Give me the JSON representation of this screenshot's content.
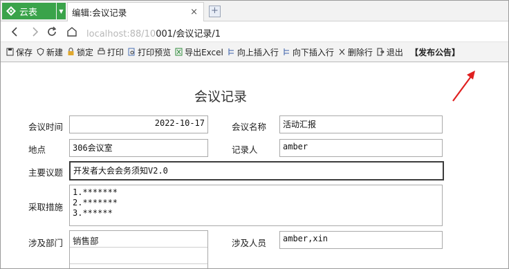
{
  "tab_bar": {
    "app_name": "云表",
    "active_tab_title": "编辑:会议记录",
    "close_glyph": "×",
    "new_tab_glyph": "+"
  },
  "address_bar": {
    "url_faded": "localhost:88/10",
    "url_main": "001/会议记录/1"
  },
  "toolbar": {
    "save": "保存",
    "new": "新建",
    "lock": "锁定",
    "print": "打印",
    "print_preview": "打印预览",
    "export_excel": "导出Excel",
    "insert_above": "向上插入行",
    "insert_below": "向下插入行",
    "delete_row": "删除行",
    "exit": "退出",
    "publish_announcement": "【发布公告】"
  },
  "form": {
    "title": "会议记录",
    "meeting_time_label": "会议时间",
    "meeting_time_value": "2022-10-17",
    "meeting_name_label": "会议名称",
    "meeting_name_value": "活动汇报",
    "location_label": "地点",
    "location_value": "306会议室",
    "recorder_label": "记录人",
    "recorder_value": "amber",
    "topic_label": "主要议题",
    "topic_value": "开发者大会会务须知V2.0",
    "measures_label": "采取措施",
    "measures_lines": [
      "1.*******",
      "2.*******",
      "3.******"
    ],
    "department_label": "涉及部门",
    "departments": [
      "销售部",
      "",
      ""
    ],
    "people_label": "涉及人员",
    "people_value": "amber,xin"
  },
  "colors": {
    "app_green": "#3aa34a",
    "annotation_arrow": "#e02020"
  }
}
